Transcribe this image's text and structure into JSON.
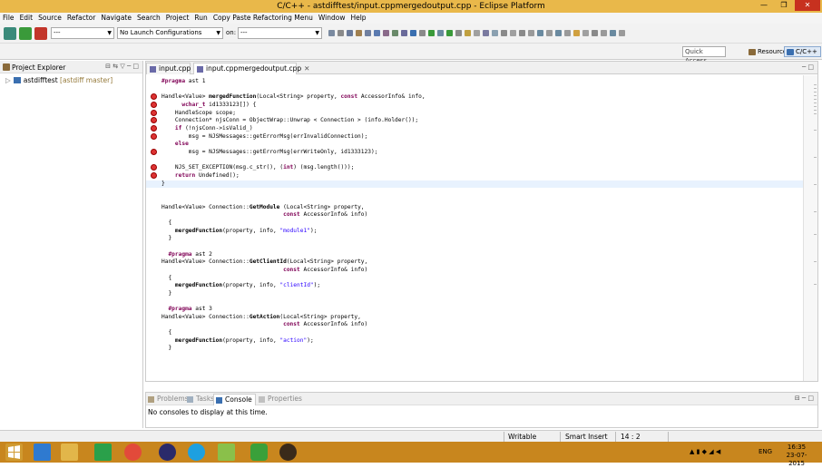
{
  "window": {
    "title": "C/C++ - astdifftest/input.cppmergedoutput.cpp - Eclipse Platform",
    "minimize": "—",
    "maximize": "❐",
    "close": "✕"
  },
  "menu": [
    "File",
    "Edit",
    "Source",
    "Refactor",
    "Navigate",
    "Search",
    "Project",
    "Run",
    "Copy Paste Refactoring Menu",
    "Window",
    "Help"
  ],
  "toolbar": {
    "mode_combo": "---",
    "launch_combo": "No Launch Configurations",
    "on_label": "on:",
    "target_combo": "---"
  },
  "perspectives": {
    "quick_access": "Quick Access",
    "resource": "Resource",
    "cpp": "C/C++"
  },
  "project_explorer": {
    "title": "Project Explorer",
    "controls": "⊟ ⇆ ▽ ─ □",
    "project": "astdifftest",
    "repo": "[astdiff master]"
  },
  "editor": {
    "tabs": [
      {
        "label": "input.cpp",
        "active": false
      },
      {
        "label": "input.cppmergedoutput.cpp",
        "active": true
      }
    ],
    "close_glyph": "✕",
    "min_controls": "─ □"
  },
  "code_lines": [
    "#pragma ast 1",
    "",
    "Handle<Value> mergedFunction(Local<String> property, const AccessorInfo& info,",
    "      wchar_t id1333123[]) {",
    "    HandleScope scope;",
    "    Connection* njsConn = ObjectWrap::Unwrap < Connection > (info.Holder());",
    "    if (!njsConn->isValid_)",
    "        msg = NJSMessages::getErrorMsg(errInvalidConnection);",
    "    else",
    "        msg = NJSMessages::getErrorMsg(errWriteOnly, id1333123);",
    "",
    "    NJS_SET_EXCEPTION(msg.c_str(), (int) (msg.length()));",
    "    return Undefined();",
    "}",
    "",
    "",
    "Handle<Value> Connection::GetModule (Local<String> property,",
    "                                    const AccessorInfo& info)",
    "  {",
    "    mergedFunction(property, info, \"module1\");",
    "  }",
    "",
    "  #pragma ast 2",
    "Handle<Value> Connection::GetClientId(Local<String> property,",
    "                                    const AccessorInfo& info)",
    "  {",
    "    mergedFunction(property, info, \"clientId\");",
    "  }",
    "",
    "  #pragma ast 3",
    "Handle<Value> Connection::GetAction(Local<String> property,",
    "                                    const AccessorInfo& info)",
    "  {",
    "    mergedFunction(property, info, \"action\");",
    "  }"
  ],
  "console": {
    "tabs": [
      "Problems",
      "Tasks",
      "Console",
      "Properties"
    ],
    "active_tab": "Console",
    "message": "No consoles to display at this time.",
    "controls": "⊟ ─ □"
  },
  "status": {
    "writable": "Writable",
    "insert_mode": "Smart Insert",
    "position": "14 : 2"
  },
  "taskbar": {
    "language": "ENG",
    "time": "16:35",
    "date": "23-07-2015"
  },
  "colors": {
    "titlebar": "#e9b84a",
    "taskbar": "#c8861e",
    "keyword": "#7f0055",
    "string": "#2a00ff",
    "error": "#d33333"
  }
}
